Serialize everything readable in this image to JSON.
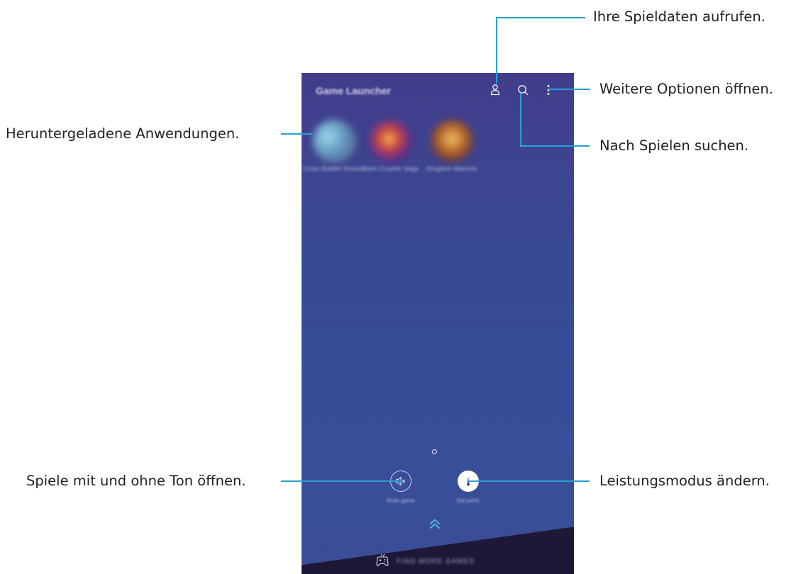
{
  "app": {
    "title": "Game Launcher"
  },
  "games": [
    {
      "name": "Cross Bubble Shooter"
    },
    {
      "name": "Gem Crusher Saga"
    },
    {
      "name": "Kingdom Warriors"
    }
  ],
  "bottom_controls": {
    "mute_label": "Mute game",
    "mode_label": "Bal perfo"
  },
  "find_more": {
    "label": "FIND MORE GAMES"
  },
  "callouts": {
    "profile": "Ihre Spieldaten aufrufen.",
    "more_options": "Weitere Optionen öffnen.",
    "search": "Nach Spielen suchen.",
    "downloaded": "Heruntergeladene Anwendungen.",
    "mute": "Spiele mit und ohne Ton öffnen.",
    "performance": "Leistungsmodus ändern."
  },
  "colors": {
    "callout_line": "#29a0d6",
    "screen_bg": "#3a4892",
    "bottom_bar": "#1d1836",
    "accent_chevron": "#4fc3f7"
  },
  "icons": {
    "profile": "person-icon",
    "search": "search-icon",
    "more": "more-vert-icon",
    "mute": "volume-mute-icon",
    "performance": "performance-gauge-icon",
    "expand": "chevron-double-up-icon",
    "find_more": "game-controller-icon"
  }
}
